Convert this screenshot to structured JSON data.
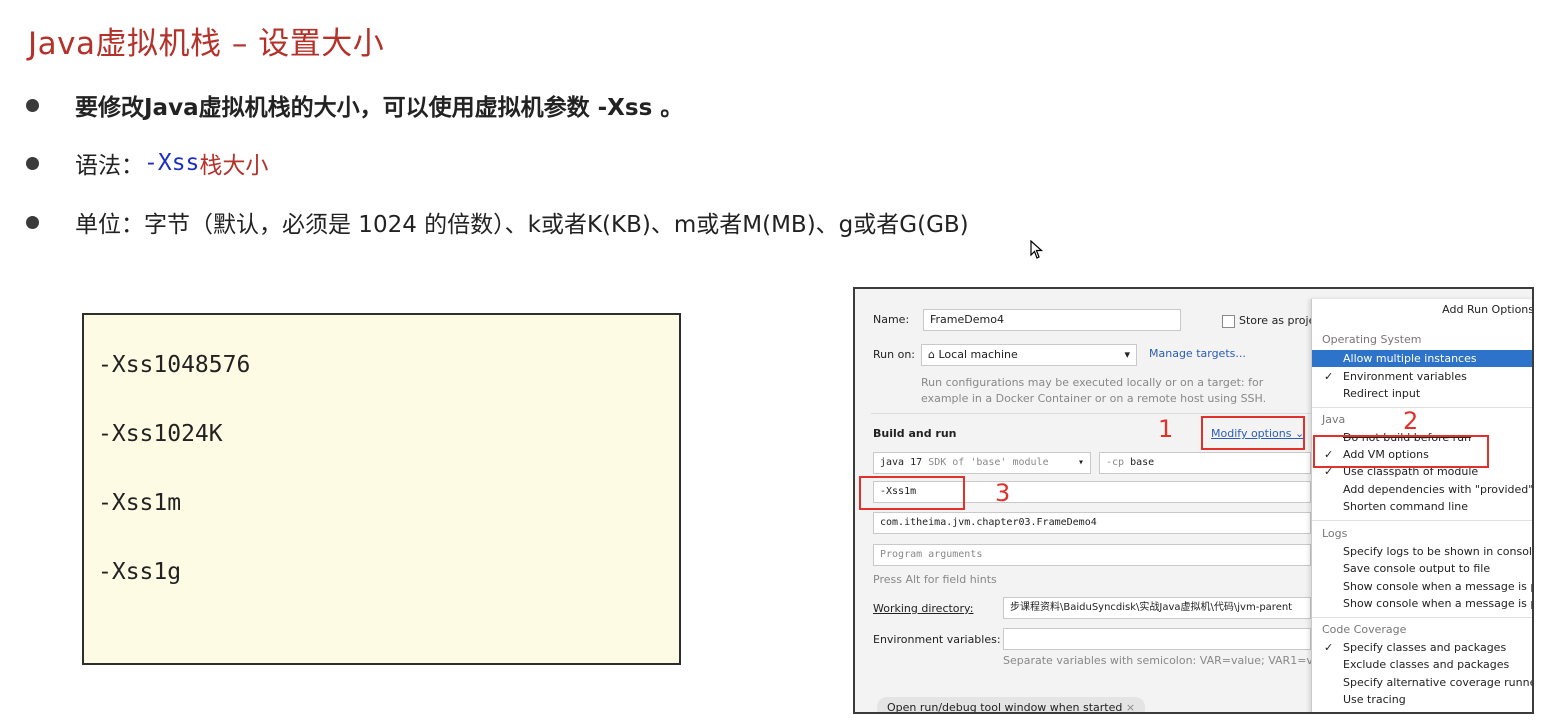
{
  "slide": {
    "title": "Java虚拟机栈 – 设置大小",
    "bullet1": "要修改Java虚拟机栈的大小，可以使用虚拟机参数 -Xss 。",
    "bullet2_prefix": "语法：",
    "bullet2_code": "-Xss",
    "bullet2_suffix": "栈大小",
    "bullet3": "单位：字节（默认，必须是 1024 的倍数）、k或者K(KB)、m或者M(MB)、g或者G(GB)"
  },
  "code_examples": [
    "-Xss1048576",
    "-Xss1024K",
    "-Xss1m",
    "-Xss1g"
  ],
  "dialog": {
    "name_label": "Name:",
    "name_value": "FrameDemo4",
    "store_label": "Store as proje",
    "run_on_label": "Run on:",
    "run_on_value": "Local machine",
    "manage_targets": "Manage targets...",
    "hint_line1": "Run configurations may be executed locally or on a target: for",
    "hint_line2": "example in a Docker Container or on a remote host using SSH.",
    "build_and_run": "Build and run",
    "modify_options": "Modify options",
    "sdk_java": "java 17",
    "sdk_desc": "SDK of 'base' module",
    "cp_label": "-cp",
    "cp_value": "base",
    "vm_options": "-Xss1m",
    "main_class": "com.itheima.jvm.chapter03.FrameDemo4",
    "program_args_placeholder": "Program arguments",
    "field_hints": "Press Alt for field hints",
    "working_dir_label": "Working directory:",
    "working_dir_value": "步课程资料\\BaiduSyncdisk\\实战Java虚拟机\\代码\\jvm-parent",
    "env_label": "Environment variables:",
    "env_hint": "Separate variables with semicolon: VAR=value; VAR1=value",
    "open_window_pill": "Open run/debug tool window when started",
    "annotations": [
      "1",
      "2",
      "3"
    ]
  },
  "menu": {
    "header": "Add Run Options",
    "sections": [
      {
        "title": "Operating System",
        "items": [
          {
            "label": "Allow multiple instances",
            "checked": false,
            "selected": true
          },
          {
            "label": "Environment variables",
            "checked": true
          },
          {
            "label": "Redirect input",
            "checked": false
          }
        ]
      },
      {
        "title": "Java",
        "items": [
          {
            "label": "Do not build before run",
            "checked": false
          },
          {
            "label": "Add VM options",
            "checked": true
          },
          {
            "label": "Use classpath of module",
            "checked": true
          },
          {
            "label": "Add dependencies with \"provided\" sc",
            "checked": false
          },
          {
            "label": "Shorten command line",
            "checked": false
          }
        ]
      },
      {
        "title": "Logs",
        "items": [
          {
            "label": "Specify logs to be shown in console",
            "checked": false
          },
          {
            "label": "Save console output to file",
            "checked": false
          },
          {
            "label": "Show console when a message is prin",
            "checked": false
          },
          {
            "label": "Show console when a message is prin",
            "checked": false
          }
        ]
      },
      {
        "title": "Code Coverage",
        "items": [
          {
            "label": "Specify classes and packages",
            "checked": true
          },
          {
            "label": "Exclude classes and packages",
            "checked": false
          },
          {
            "label": "Specify alternative coverage runner",
            "checked": false
          },
          {
            "label": "Use tracing",
            "checked": false
          }
        ]
      }
    ]
  },
  "colors": {
    "title_red": "#b5322b",
    "code_blue": "#1b2fc4",
    "annotation_red": "#e0312a",
    "selection_blue": "#2d73c9"
  }
}
